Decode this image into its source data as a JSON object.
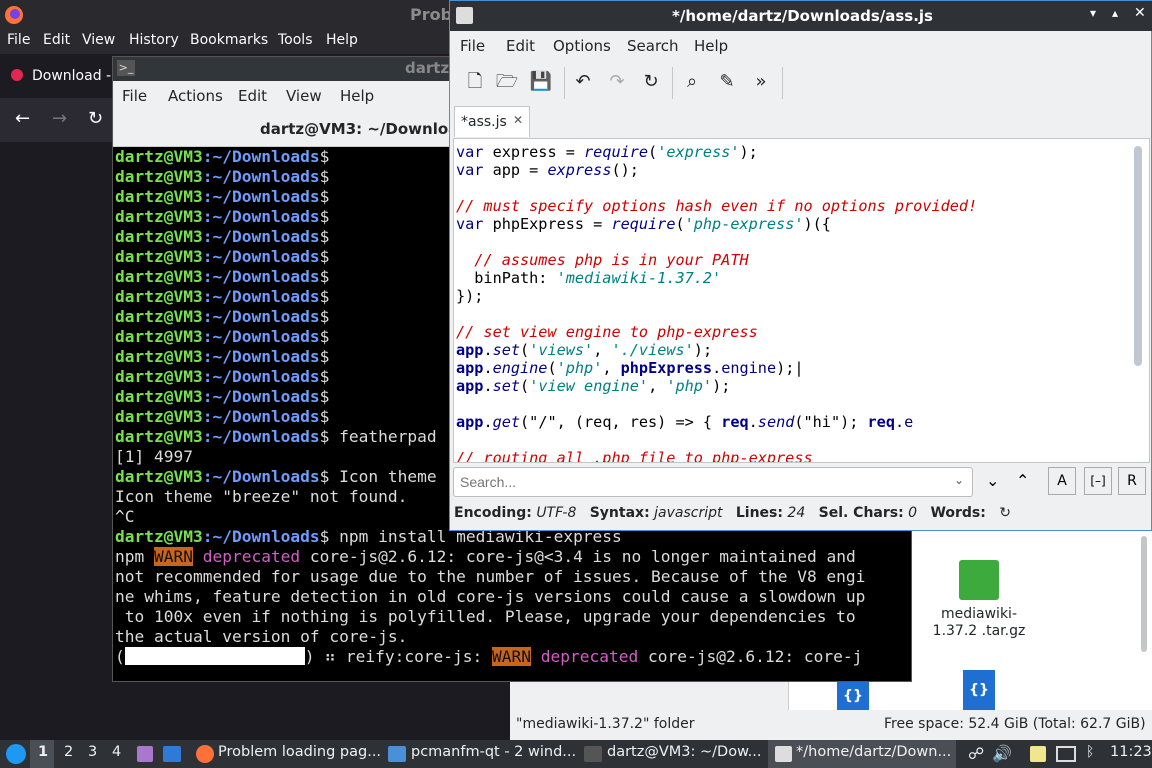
{
  "firefox": {
    "title": "Prob",
    "menu": [
      "File",
      "Edit",
      "View",
      "History",
      "Bookmarks",
      "Tools",
      "Help"
    ],
    "tab_label": "Download -"
  },
  "terminal": {
    "title": "dartz",
    "menu": [
      "File",
      "Actions",
      "Edit",
      "View",
      "Help"
    ],
    "path_title": "dartz@VM3: ~/Downloads",
    "prompt_user": "dartz@VM3",
    "prompt_dir": ":~/Downloads",
    "cmd_featherpad": " featherpad",
    "job": "[1] 4997",
    "cmd_icon": " Icon theme",
    "icon_not_found": "Icon theme \"breeze\" not found.",
    "ctrl_c": "^C",
    "cmd_npm": " npm install mediawiki-express",
    "npm_prefix": "npm ",
    "warn": "WARN",
    "deprecated": "deprecated",
    "npm_msg1": " core-js@2.6.12: core-js@<3.4 is no longer maintained and",
    "npm_msg2": "not recommended for usage due to the number of issues. Because of the V8 engi",
    "npm_msg3": "ne whims, feature detection in old core-js versions could cause a slowdown up",
    "npm_msg4": " to 100x even if nothing is polyfilled. Please, upgrade your dependencies to",
    "npm_msg5": "the actual version of core-js.",
    "reify_prefix": ") ⠶ reify:core-js: ",
    "reify_suffix": " core-js@2.6.12: core-j"
  },
  "file_manager": {
    "file_name": "mediawiki-1.37.2 .tar.gz",
    "status_left": "\"mediawiki-1.37.2\" folder",
    "status_right": "Free space: 52.4 GiB (Total: 62.7 GiB)"
  },
  "editor": {
    "title": "*/home/dartz/Downloads/ass.js",
    "menu": [
      "File",
      "Edit",
      "Options",
      "Search",
      "Help"
    ],
    "tab_label": "*ass.js",
    "search_placeholder": "Search...",
    "status": {
      "encoding_label": "Encoding:",
      "encoding": "UTF-8",
      "syntax_label": "Syntax:",
      "syntax": "javascript",
      "lines_label": "Lines:",
      "lines": "24",
      "sel_label": "Sel. Chars:",
      "sel": "0",
      "words_label": "Words:"
    }
  },
  "taskbar": {
    "workspaces": [
      "1",
      "2",
      "3",
      "4"
    ],
    "tasks": [
      "Problem loading pag...",
      "pcmanfm-qt - 2 wind...",
      "dartz@VM3: ~/Dow...",
      "*/home/dartz/Down..."
    ],
    "clock": "11:23"
  },
  "colors": {
    "editor_border": "#4a90d9",
    "prompt_green": "#78e14c",
    "prompt_blue": "#6f9cff",
    "warn_bg": "#c8661e"
  }
}
